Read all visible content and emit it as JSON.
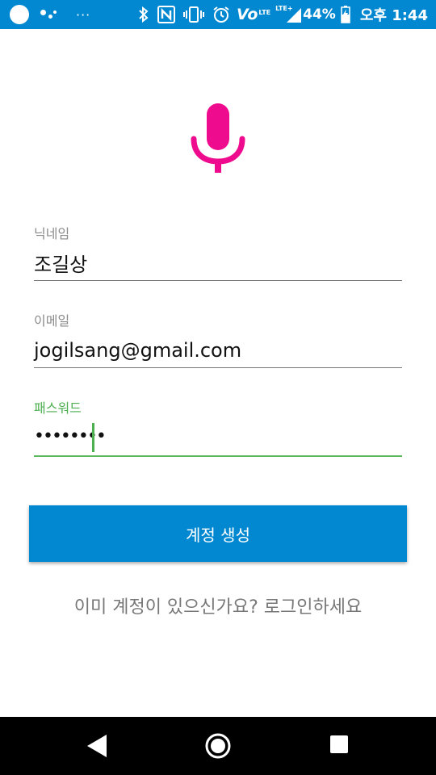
{
  "status_bar": {
    "more": "···",
    "volte": "Vo",
    "volte_sub": "LTE",
    "network": "LTE+",
    "battery_percent": "44%",
    "time": "오후 1:44",
    "colors": {
      "background": "#0288d1",
      "icon": "#ffffff"
    }
  },
  "app": {
    "mic_icon": "microphone-icon",
    "mic_color": "#ee0b8e"
  },
  "form": {
    "nickname": {
      "label": "닉네임",
      "value": "조길상"
    },
    "email": {
      "label": "이메일",
      "value": "jogilsang@gmail.com"
    },
    "password": {
      "label": "패스워드",
      "value": "••••••••",
      "focused": true,
      "accent": "#4caf50"
    }
  },
  "create_button": {
    "label": "계정 생성",
    "color": "#0288d1"
  },
  "login_link": {
    "text": "이미 계정이 있으신가요? 로그인하세요"
  },
  "nav_bar": {
    "back_icon": "back-triangle-icon",
    "home_icon": "home-circle-icon",
    "recents_icon": "recents-square-icon"
  }
}
